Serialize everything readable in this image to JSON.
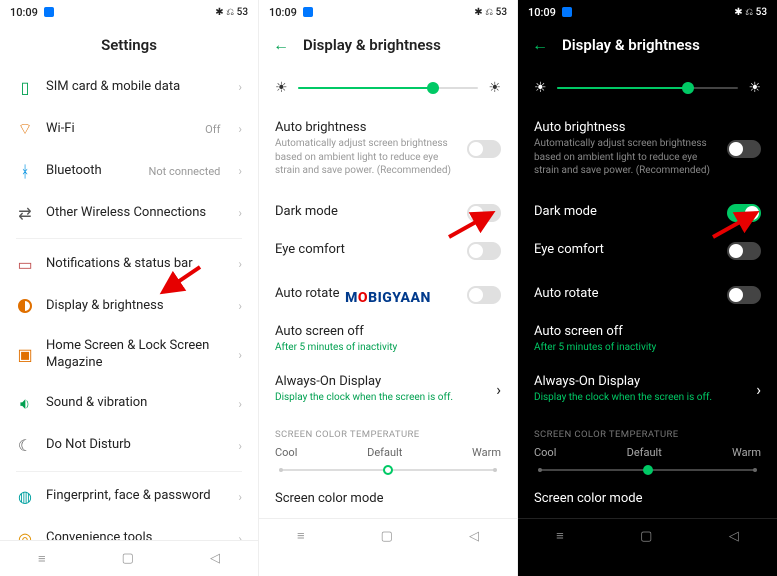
{
  "status": {
    "time": "10:09",
    "icons": "✱ ⎌ 53"
  },
  "screen1": {
    "title": "Settings",
    "items": [
      {
        "label": "SIM card & mobile data"
      },
      {
        "label": "Wi-Fi",
        "meta": "Off"
      },
      {
        "label": "Bluetooth",
        "meta": "Not connected"
      },
      {
        "label": "Other Wireless Connections"
      },
      {
        "label": "Notifications & status bar"
      },
      {
        "label": "Display & brightness"
      },
      {
        "label": "Home Screen & Lock Screen Magazine"
      },
      {
        "label": "Sound & vibration"
      },
      {
        "label": "Do Not Disturb"
      },
      {
        "label": "Fingerprint, face & password"
      },
      {
        "label": "Convenience tools"
      }
    ]
  },
  "screen2": {
    "title": "Display & brightness",
    "brightness_pct": 75,
    "auto_b": {
      "title": "Auto brightness",
      "sub": "Automatically adjust screen brightness based on ambient light to reduce eye strain and save power. (Recommended)",
      "on": false
    },
    "dark_mode": {
      "title": "Dark mode",
      "on": false
    },
    "eye": {
      "title": "Eye comfort",
      "on": false
    },
    "auto_rotate": {
      "title": "Auto rotate",
      "on": false
    },
    "auto_off": {
      "title": "Auto screen off",
      "sub": "After 5 minutes of inactivity"
    },
    "aod": {
      "title": "Always-On Display",
      "sub": "Display the clock when the screen is off."
    },
    "sect_temp": "SCREEN COLOR TEMPERATURE",
    "temp": {
      "cool": "Cool",
      "def": "Default",
      "warm": "Warm"
    },
    "color_mode": "Screen color mode"
  },
  "screen3": {
    "title": "Display & brightness",
    "brightness_pct": 72,
    "auto_b": {
      "title": "Auto brightness",
      "sub": "Automatically adjust screen brightness based on ambient light to reduce eye strain and save power. (Recommended)",
      "on": false
    },
    "dark_mode": {
      "title": "Dark mode",
      "on": true
    },
    "eye": {
      "title": "Eye comfort",
      "on": false
    },
    "auto_rotate": {
      "title": "Auto rotate",
      "on": false
    },
    "auto_off": {
      "title": "Auto screen off",
      "sub": "After 5 minutes of inactivity"
    },
    "aod": {
      "title": "Always-On Display",
      "sub": "Display the clock when the screen is off."
    },
    "sect_temp": "SCREEN COLOR TEMPERATURE",
    "temp": {
      "cool": "Cool",
      "def": "Default",
      "warm": "Warm"
    },
    "color_mode": "Screen color mode"
  },
  "watermark": "MOBIGYAAN"
}
